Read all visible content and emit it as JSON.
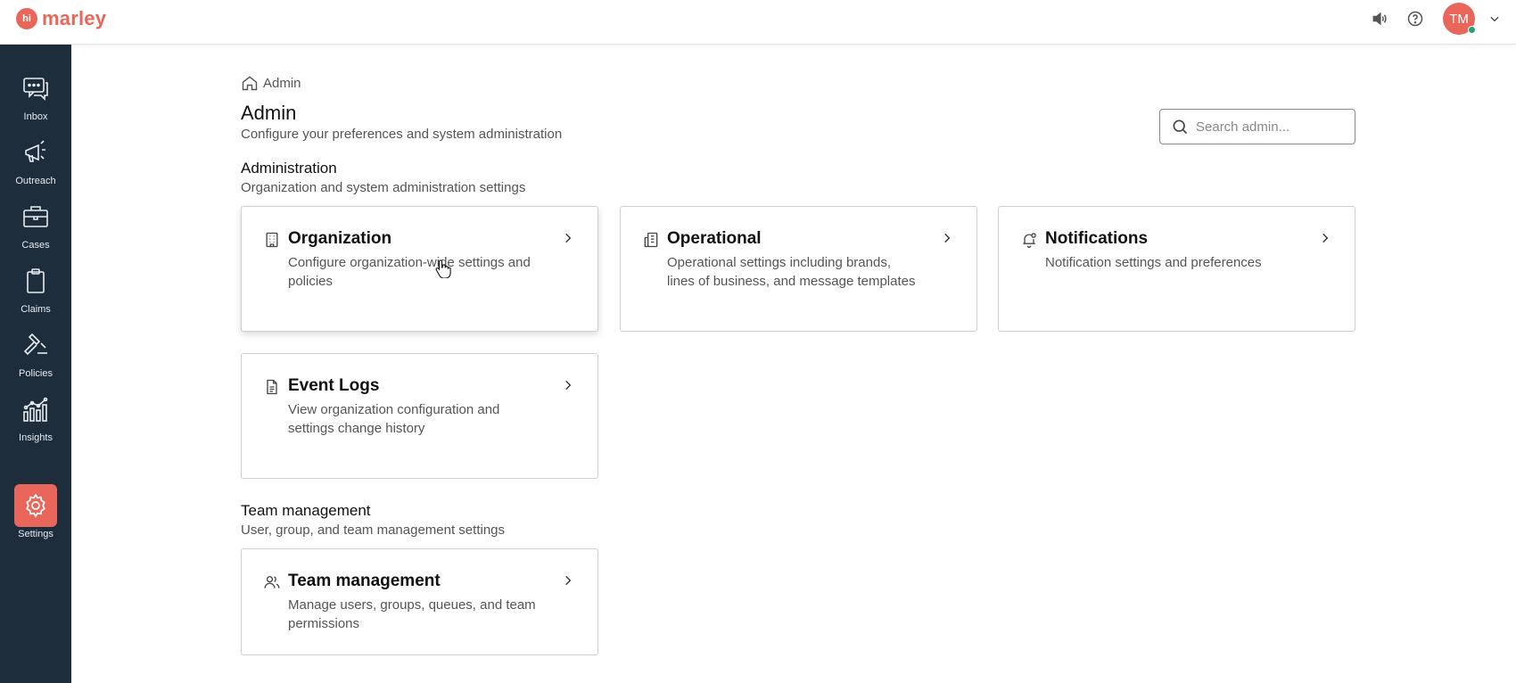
{
  "app": {
    "logo_badge": "hi",
    "logo_text": "marley",
    "avatar_initials": "TM",
    "accent_color": "#e9675a",
    "sidebar_color": "#1d2d3c"
  },
  "sidebar": {
    "items": [
      {
        "label": "Inbox",
        "icon": "chat-bubbles-icon"
      },
      {
        "label": "Outreach",
        "icon": "megaphone-icon"
      },
      {
        "label": "Cases",
        "icon": "briefcase-icon"
      },
      {
        "label": "Claims",
        "icon": "clipboard-icon"
      },
      {
        "label": "Policies",
        "icon": "gavel-icon"
      },
      {
        "label": "Insights",
        "icon": "bar-chart-icon"
      },
      {
        "label": "Settings",
        "icon": "gear-icon",
        "active": true
      }
    ]
  },
  "breadcrumb": {
    "label": "Admin"
  },
  "page": {
    "title": "Admin",
    "subtitle": "Configure your preferences and system administration"
  },
  "search": {
    "placeholder": "Search admin..."
  },
  "sections": {
    "administration": {
      "title": "Administration",
      "subtitle": "Organization and system administration settings",
      "cards": [
        {
          "title": "Organization",
          "desc": "Configure organization-wide settings and policies",
          "icon": "building-icon"
        },
        {
          "title": "Operational",
          "desc": "Operational settings including brands, lines of business, and message templates",
          "icon": "office-building-icon"
        },
        {
          "title": "Notifications",
          "desc": "Notification settings and preferences",
          "icon": "bell-icon"
        },
        {
          "title": "Event Logs",
          "desc": "View organization configuration and settings change history",
          "icon": "document-icon"
        }
      ]
    },
    "team": {
      "title": "Team management",
      "subtitle": "User, group, and team management settings",
      "cards": [
        {
          "title": "Team management",
          "desc": "Manage users, groups, queues, and team permissions",
          "icon": "users-icon"
        }
      ]
    }
  }
}
